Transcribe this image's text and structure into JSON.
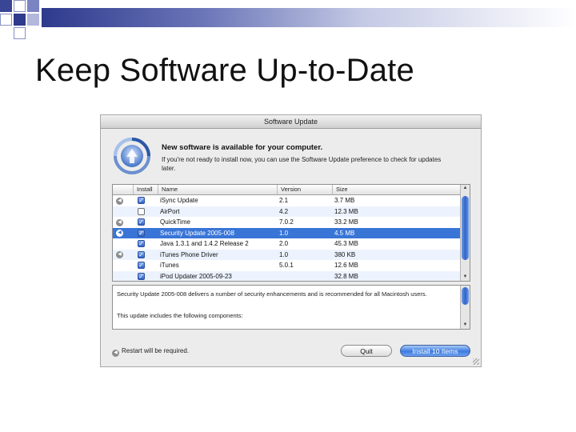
{
  "slide": {
    "title": "Keep Software Up-to-Date"
  },
  "window": {
    "title": "Software Update",
    "headline": "New software is available for your computer.",
    "subtext": "If you're not ready to install now, you can use the Software Update preference to check for updates later.",
    "columns": {
      "install": "Install",
      "name": "Name",
      "version": "Version",
      "size": "Size"
    },
    "rows": [
      {
        "restart": true,
        "checked": true,
        "name": "iSync Update",
        "version": "2.1",
        "size": "3.7 MB"
      },
      {
        "restart": false,
        "checked": false,
        "name": "AirPort",
        "version": "4.2",
        "size": "12.3 MB"
      },
      {
        "restart": true,
        "checked": true,
        "name": "QuickTime",
        "version": "7.0.2",
        "size": "33.2 MB"
      },
      {
        "restart": true,
        "checked": true,
        "name": "Security Update 2005-008",
        "version": "1.0",
        "size": "4.5 MB",
        "selected": true
      },
      {
        "restart": false,
        "checked": true,
        "name": "Java 1.3.1 and 1.4.2 Release 2",
        "version": "2.0",
        "size": "45.3 MB"
      },
      {
        "restart": true,
        "checked": true,
        "name": "iTunes Phone Driver",
        "version": "1.0",
        "size": "380 KB"
      },
      {
        "restart": false,
        "checked": true,
        "name": "iTunes",
        "version": "5.0.1",
        "size": "12.6 MB"
      },
      {
        "restart": false,
        "checked": true,
        "name": "iPod Updater 2005-09-23",
        "version": "",
        "size": "32.8 MB"
      }
    ],
    "description": "Security Update 2005-008 delivers a number of security enhancements and is recommended for all Macintosh users.",
    "description_2": "This update includes the following components:",
    "restart_note": "Restart will be required.",
    "quit_label": "Quit",
    "install_label": "Install 10 Items"
  },
  "colors": {
    "selection": "#3875d7",
    "alt_row": "#edf3fe",
    "accent": "#2f64c8"
  }
}
